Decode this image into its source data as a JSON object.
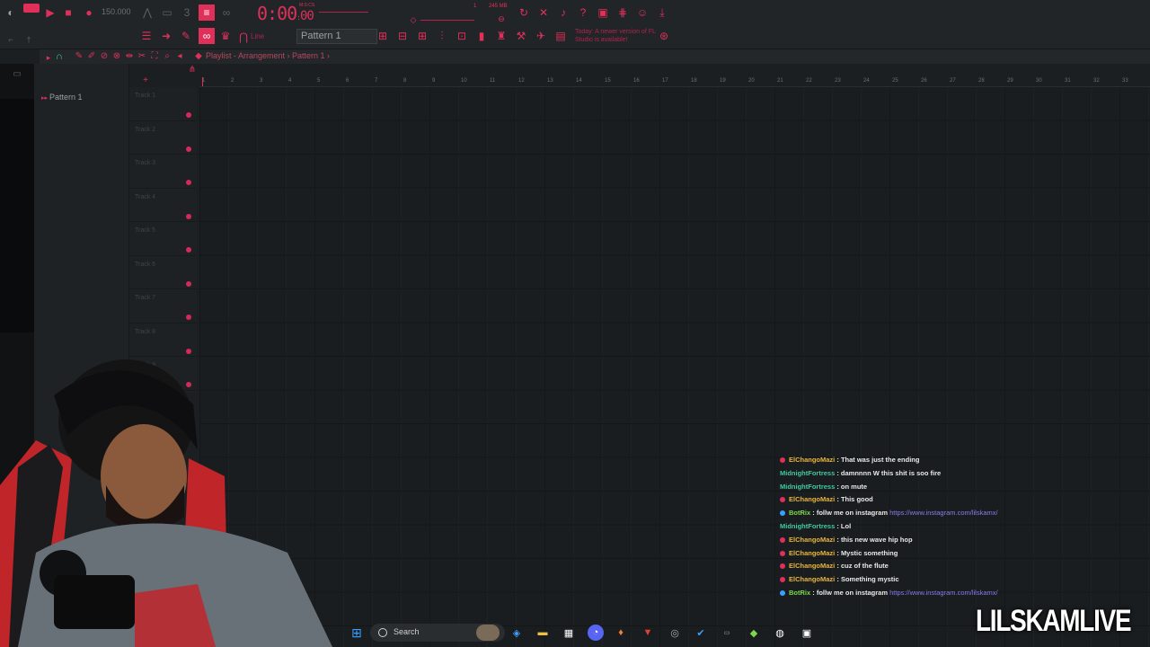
{
  "toolbar": {
    "tempo": "150.000",
    "time_main": "0:00",
    "time_sub": "00",
    "time_unit": "M:S:CS",
    "cpu_mem": "245 MB",
    "cpu_count": "1",
    "pattern_name": "Pattern 1",
    "snap_label": "Line",
    "update_hint": "Today: A newer version of FL Studio is available!"
  },
  "playlist": {
    "title_path": "Playlist - Arrangement › Pattern 1 ›",
    "picker_item": "Pattern 1",
    "tracks": [
      "Track 1",
      "Track 2",
      "Track 3",
      "Track 4",
      "Track 5",
      "Track 6",
      "Track 7",
      "Track 8",
      "Track 9"
    ],
    "bars": [
      "1",
      "2",
      "3",
      "4",
      "5",
      "6",
      "7",
      "8",
      "9",
      "10",
      "11",
      "12",
      "13",
      "14",
      "15",
      "16",
      "17",
      "18",
      "19",
      "20",
      "21",
      "22",
      "23",
      "24",
      "25",
      "26",
      "27",
      "28",
      "29",
      "30",
      "31",
      "32",
      "33"
    ]
  },
  "chat": [
    {
      "user": "ElChangoMazi",
      "style": "gold",
      "badge": true,
      "text": "That was just the ending"
    },
    {
      "user": "MidnightFortress",
      "style": "green",
      "badge": false,
      "text": "damnnnn W this shit is soo fire"
    },
    {
      "user": "MidnightFortress",
      "style": "green",
      "badge": false,
      "text": "on mute"
    },
    {
      "user": "ElChangoMazi",
      "style": "gold",
      "badge": true,
      "text": "This good"
    },
    {
      "user": "BotRix",
      "style": "bot",
      "badge": true,
      "text": "follw me on instagram",
      "link": "https://www.instagram.com/lilskamx/"
    },
    {
      "user": "MidnightFortress",
      "style": "green",
      "badge": false,
      "text": "Lol"
    },
    {
      "user": "ElChangoMazi",
      "style": "gold",
      "badge": true,
      "text": "this new wave hip hop"
    },
    {
      "user": "ElChangoMazi",
      "style": "gold",
      "badge": true,
      "text": "Mystic something"
    },
    {
      "user": "ElChangoMazi",
      "style": "gold",
      "badge": true,
      "text": "cuz of the flute"
    },
    {
      "user": "ElChangoMazi",
      "style": "gold",
      "badge": true,
      "text": "Something mystic"
    },
    {
      "user": "BotRix",
      "style": "bot",
      "badge": true,
      "text": "follw me on instagram",
      "link": "https://www.instagram.com/lilskamx/"
    }
  ],
  "taskbar": {
    "search_label": "Search"
  },
  "overlay": {
    "brand": "LILSKAMLIVE"
  },
  "colors": {
    "accent": "#e0305a",
    "bg": "#1c1f21"
  }
}
